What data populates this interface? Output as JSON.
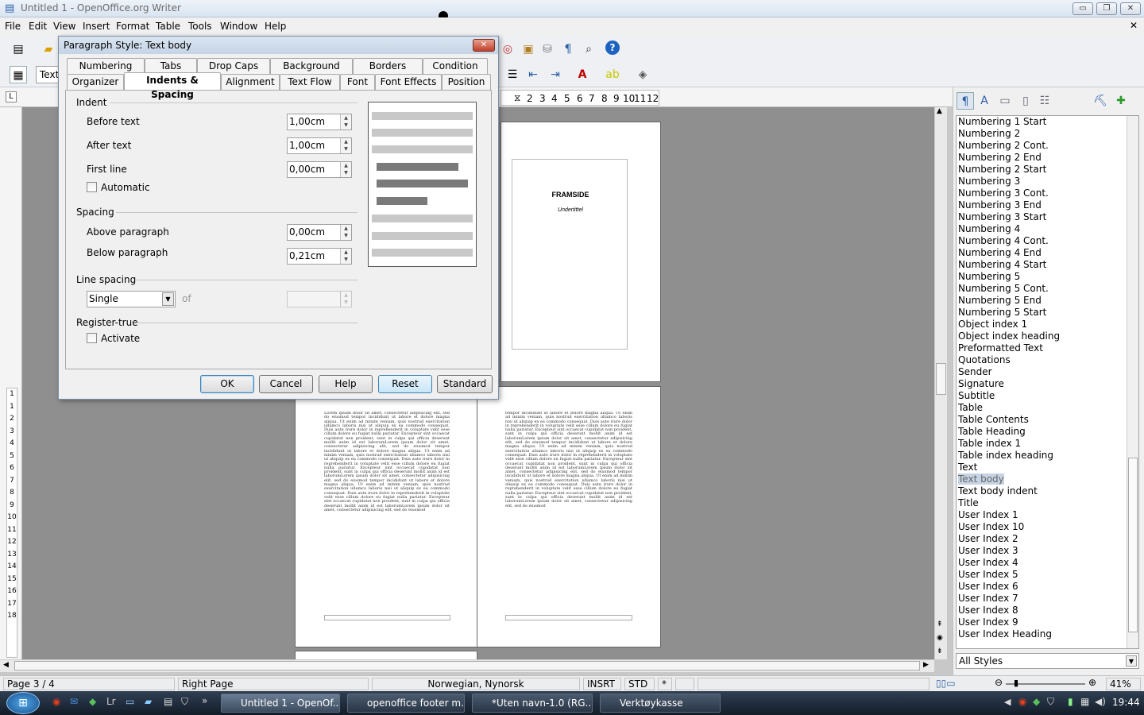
{
  "window": {
    "title": "Untitled 1 - OpenOffice.org Writer",
    "minimize": "▭",
    "restore": "❐",
    "close": "✕",
    "doc_close": "✕"
  },
  "menu": [
    "File",
    "Edit",
    "View",
    "Insert",
    "Format",
    "Table",
    "Tools",
    "Window",
    "Help"
  ],
  "toolbar2": {
    "style_box": "Text"
  },
  "ruler": {
    "ticks": [
      "2",
      "3",
      "4",
      "5",
      "6",
      "7",
      "8",
      "9",
      "10",
      "11",
      "12"
    ]
  },
  "vruler": {
    "ticks": [
      "1",
      "1",
      "2",
      "3",
      "4",
      "5",
      "6",
      "7",
      "8",
      "9",
      "10",
      "11",
      "12",
      "13",
      "14",
      "15",
      "16",
      "17",
      "18"
    ]
  },
  "document": {
    "cover_title": "FRAMSIDE",
    "cover_subtitle": "Undertittel",
    "lorem_left": "Lorem ipsum dolor sit amet, consectetur adipisicing elit, sed do eiusmod tempor incididunt ut labore et dolore magna aliqua. Ut enim ad minim veniam, quis nostrud exercitation ullamco laboris nisi ut aliquip ex ea commodo consequat. Duis aute irure dolor in reprehenderit in voluptate velit esse cillum dolore eu fugiat nulla pariatur. Excepteur sint occaecat cupidatat non proident, sunt in culpa qui officia deserunt mollit anim id est laborumLorem ipsum dolor sit amet, consectetur adipisicing elit, sed do eiusmod tempor incididunt ut labore et dolore magna aliqua. Ut enim ad minim veniam, quis nostrud exercitation ullamco laboris nisi ut aliquip ex ea commodo consequat. Duis aute irure dolor in reprehenderit in voluptate velit esse cillum dolore eu fugiat nulla pariatur. Excepteur sint occaecat cupidatat non proident, sunt in culpa qui officia deserunt mollit anim id est laborumLorem ipsum dolor sit amet, consectetur adipisicing elit, sed do eiusmod tempor incididunt ut labore et dolore magna aliqua. Ut enim ad minim veniam, quis nostrud exercitation ullamco laboris nisi ut aliquip ex ea commodo consequat. Duis aute irure dolor in reprehenderit in voluptate velit esse cillum dolore eu fugiat nulla pariatur. Excepteur sint occaecat cupidatat non proident, sunt in culpa qui officia deserunt mollit anim id est laborumLorem ipsum dolor sit amet, consectetur adipisicing elit, sed do eiusmod",
    "lorem_right": "tempor incididunt ut labore et dolore magna aliqua. Ut enim ad minim veniam, quis nostrud exercitation ullamco laboris nisi ut aliquip ex ea commodo consequat. Duis aute irure dolor in reprehenderit in voluptate velit esse cillum dolore eu fugiat nulla pariatur. Excepteur sint occaecat cupidatat non proident, sunt in culpa qui officia deserunt mollit anim id est laborumLorem ipsum dolor sit amet, consectetur adipisicing elit, sed do eiusmod tempor incididunt ut labore et dolore magna aliqua. Ut enim ad minim veniam, quis nostrud exercitation ullamco laboris nisi ut aliquip ex ea commodo consequat. Duis aute irure dolor in reprehenderit in voluptate velit esse cillum dolore eu fugiat nulla pariatur. Excepteur sint occaecat cupidatat non proident, sunt in culpa qui officia deserunt mollit anim id est laborumLorem ipsum dolor sit amet, consectetur adipisicing elit, sed do eiusmod tempor incididunt ut labore et dolore magna aliqua. Ut enim ad minim veniam, quis nostrud exercitation ullamco laboris nisi ut aliquip ex ea commodo consequat. Duis aute irure dolor in reprehenderit in voluptate velit esse cillum dolore eu fugiat nulla pariatur. Excepteur sint occaecat cupidatat non proident, sunt in culpa qui officia deserunt mollit anim id est laborumLorem ipsum dolor sit amet, consectetur adipisicing elit, sed do eiusmod"
  },
  "dialog": {
    "title": "Paragraph Style: Text body",
    "tabs_row1": [
      "Numbering",
      "Tabs",
      "Drop Caps",
      "Background",
      "Borders",
      "Condition"
    ],
    "tabs_row2": [
      "Organizer",
      "Indents & Spacing",
      "Alignment",
      "Text Flow",
      "Font",
      "Font Effects",
      "Position"
    ],
    "indent": {
      "heading": "Indent",
      "before_label": "Before text",
      "before_value": "1,00cm",
      "after_label": "After text",
      "after_value": "1,00cm",
      "first_label": "First line",
      "first_value": "0,00cm",
      "automatic": "Automatic"
    },
    "spacing": {
      "heading": "Spacing",
      "above_label": "Above paragraph",
      "above_value": "0,00cm",
      "below_label": "Below paragraph",
      "below_value": "0,21cm"
    },
    "line_spacing": {
      "heading": "Line spacing",
      "value": "Single",
      "of_label": "of",
      "of_value": ""
    },
    "register": {
      "heading": "Register-true",
      "activate": "Activate"
    },
    "buttons": {
      "ok": "OK",
      "cancel": "Cancel",
      "help": "Help",
      "reset": "Reset",
      "standard": "Standard"
    }
  },
  "stylist": {
    "items": [
      "Numbering 1 Start",
      "Numbering 2",
      "Numbering 2 Cont.",
      "Numbering 2 End",
      "Numbering 2 Start",
      "Numbering 3",
      "Numbering 3 Cont.",
      "Numbering 3 End",
      "Numbering 3 Start",
      "Numbering 4",
      "Numbering 4 Cont.",
      "Numbering 4 End",
      "Numbering 4 Start",
      "Numbering 5",
      "Numbering 5 Cont.",
      "Numbering 5 End",
      "Numbering 5 Start",
      "Object index 1",
      "Object index heading",
      "Preformatted Text",
      "Quotations",
      "Sender",
      "Signature",
      "Subtitle",
      "Table",
      "Table Contents",
      "Table Heading",
      "Table index 1",
      "Table index heading",
      "Text",
      "Text body",
      "Text body indent",
      "Title",
      "User Index 1",
      "User Index 10",
      "User Index 2",
      "User Index 3",
      "User Index 4",
      "User Index 5",
      "User Index 6",
      "User Index 7",
      "User Index 8",
      "User Index 9",
      "User Index Heading"
    ],
    "selected_index": 30,
    "filter": "All Styles"
  },
  "status": {
    "page": "Page 3 / 4",
    "page_style": "Right Page",
    "language": "Norwegian, Nynorsk",
    "insert_mode": "INSRT",
    "selection_mode": "STD",
    "modified": "*",
    "zoom": "41%"
  },
  "taskbar": {
    "tasks": [
      "Untitled 1 - OpenOf...",
      "openoffice footer m...",
      "*Uten navn-1.0 (RG...",
      "Verktøykasse"
    ],
    "clock": "19:44"
  }
}
